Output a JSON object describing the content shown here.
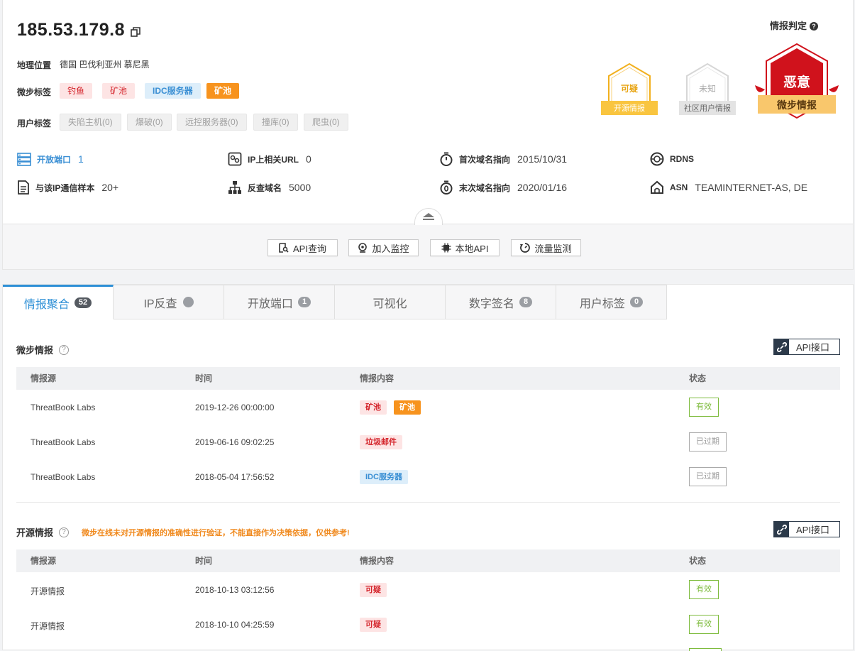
{
  "header": {
    "ip": "185.53.179.8",
    "geo_label": "地理位置",
    "geo_value": "德国 巴伐利亚州 慕尼黑",
    "tb_tags_label": "微步标签",
    "tb_tags": [
      "钓鱼",
      "矿池",
      "IDC服务器",
      "矿池"
    ],
    "user_tags_label": "用户标签",
    "user_tags": [
      "失陷主机(0)",
      "爆破(0)",
      "远控服务器(0)",
      "撞库(0)",
      "爬虫(0)"
    ]
  },
  "verdict": {
    "label": "情报判定",
    "help": "?",
    "opensource": {
      "text": "可疑",
      "ribbon": "开源情报"
    },
    "community": {
      "text": "未知",
      "ribbon": "社区用户情报"
    },
    "threatbook": {
      "text": "恶意",
      "ribbon": "微步情报"
    }
  },
  "stats": {
    "open_ports": {
      "label": "开放端口",
      "value": "1"
    },
    "ip_url": {
      "label": "IP上相关URL",
      "value": "0"
    },
    "first_domain": {
      "label": "首次域名指向",
      "value": "2015/10/31"
    },
    "rdns": {
      "label": "RDNS",
      "value": ""
    },
    "samples": {
      "label": "与该IP通信样本",
      "value": "20+"
    },
    "reverse_domain": {
      "label": "反查域名",
      "value": "5000"
    },
    "last_domain": {
      "label": "末次域名指向",
      "value": "2020/01/16"
    },
    "asn": {
      "label": "ASN",
      "value": "TEAMINTERNET-AS, DE"
    }
  },
  "actions": [
    "API查询",
    "加入监控",
    "本地API",
    "流量监测"
  ],
  "tabs": [
    {
      "label": "情报聚合",
      "badge": "52"
    },
    {
      "label": "IP反查",
      "badge": ""
    },
    {
      "label": "开放端口",
      "badge": "1"
    },
    {
      "label": "可视化",
      "badge": ""
    },
    {
      "label": "数字签名",
      "badge": "8"
    },
    {
      "label": "用户标签",
      "badge": "0"
    }
  ],
  "tb_section": {
    "title": "微步情报",
    "api_label": "API接口",
    "columns": [
      "情报源",
      "时间",
      "情报内容",
      "状态"
    ],
    "rows": [
      {
        "source": "ThreatBook Labs",
        "time": "2019-12-26 00:00:00",
        "tags": [
          "矿池",
          "矿池"
        ],
        "status": "有效"
      },
      {
        "source": "ThreatBook Labs",
        "time": "2019-06-16 09:02:25",
        "tags": [
          "垃圾邮件"
        ],
        "status": "已过期"
      },
      {
        "source": "ThreatBook Labs",
        "time": "2018-05-04 17:56:52",
        "tags": [
          "IDC服务器"
        ],
        "status": "已过期"
      }
    ]
  },
  "os_section": {
    "title": "开源情报",
    "warning": "微步在线未对开源情报的准确性进行验证，不能直接作为决策依据，仅供参考!",
    "api_label": "API接口",
    "columns": [
      "情报源",
      "时间",
      "情报内容",
      "状态"
    ],
    "rows": [
      {
        "source": "开源情报",
        "time": "2018-10-13 03:12:56",
        "tags": [
          "可疑"
        ],
        "status": "有效"
      },
      {
        "source": "开源情报",
        "time": "2018-10-10 04:25:59",
        "tags": [
          "可疑"
        ],
        "status": "有效"
      }
    ]
  },
  "colors": {
    "accent": "#2d8fd6",
    "danger": "#d0121c",
    "warning": "#f0a820",
    "valid": "#7dbb3c"
  }
}
